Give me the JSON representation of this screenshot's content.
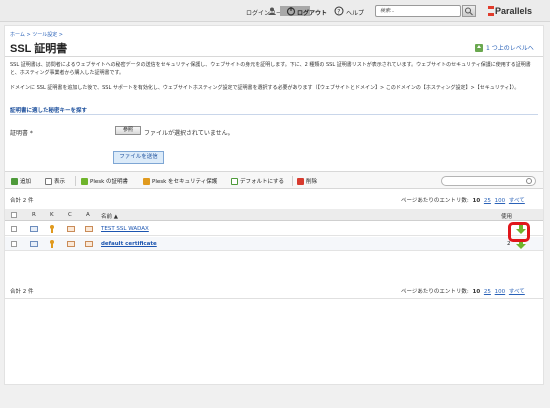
{
  "header": {
    "login_label": "ログインユーザ：",
    "logout": "ログアウト",
    "help": "ヘルプ",
    "search_placeholder": "検索...",
    "logo": "Parallels"
  },
  "breadcrumb": "ホーム > ツール設定 >",
  "page_title": "SSL 証明書",
  "up_link": "1 つ上のレベルへ",
  "description": {
    "para1": "SSL 証明書は、訪問者によるウェブサイトへの秘密データの送信をセキュリティ保護し、ウェブサイトの身元を証明します。下に、2 種類の SSL 証明書リストが表示されています。ウェブサイトのセキュリティ保護に使用する証明書と、ホスティング事業者から購入した証明書です。",
    "para2": "ドメインに SSL 証明書を追加した後で、SSL サポートを有効化し、ウェブサイトホスティング設定で証明書を選択する必要があります（【ウェブサイトとドメイン】> このドメインの【ホスティング設定】>【セキュリティ】）。"
  },
  "section_title": "証明書に適した秘密キーを探す",
  "form": {
    "cert_label": "証明書 *",
    "browse_button": "参照",
    "file_status": "ファイルが選択されていません。",
    "send_button": "ファイルを送信"
  },
  "toolbar": {
    "add": "追加",
    "show": "表示",
    "plesk_cert": "Plesk の証明書",
    "plesk_secure": "Plesk をセキュリティ保護",
    "set_default": "デフォルトにする",
    "delete": "削除"
  },
  "list": {
    "count_label": "合計 2 件",
    "per_page_label": "ページあたりのエントリ数:",
    "per_page_options": [
      "10",
      "25",
      "100",
      "すべて"
    ],
    "columns": {
      "r": "R",
      "k": "K",
      "c": "C",
      "a": "A",
      "name": "名前 ▲",
      "usage": "使用"
    },
    "rows": [
      {
        "name": "TEST SSL WADAX",
        "usage": ""
      },
      {
        "name": "default certificate",
        "usage": "2"
      }
    ]
  },
  "colors": {
    "link": "#2a62b8",
    "accent_red": "#e0161b",
    "download_green": "#6fb42c"
  }
}
